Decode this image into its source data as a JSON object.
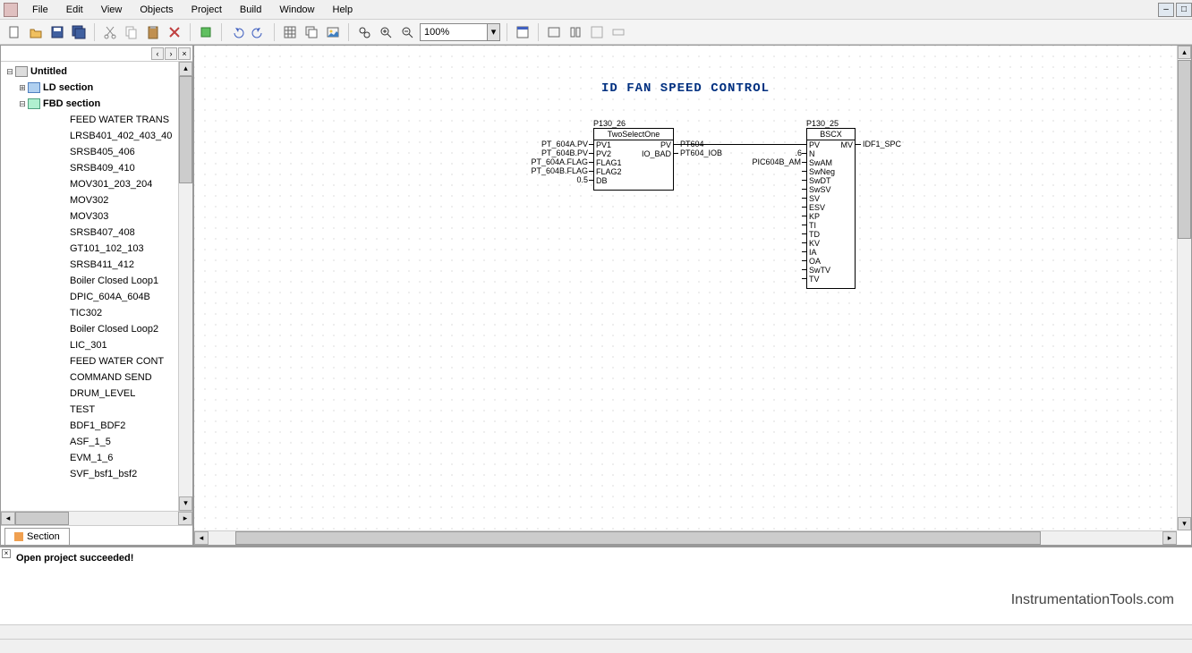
{
  "menus": [
    "File",
    "Edit",
    "View",
    "Objects",
    "Project",
    "Build",
    "Window",
    "Help"
  ],
  "zoom": "100%",
  "tree": {
    "root": "Untitled",
    "ld_label": "LD section",
    "fbd_label": "FBD section",
    "items": [
      "FEED WATER TRANS",
      "LRSB401_402_403_40",
      "SRSB405_406",
      "SRSB409_410",
      "MOV301_203_204",
      "MOV302",
      "MOV303",
      "SRSB407_408",
      "GT101_102_103",
      "SRSB411_412",
      "Boiler Closed Loop1",
      "DPIC_604A_604B",
      "TIC302",
      "Boiler Closed Loop2",
      "LIC_301",
      "FEED WATER CONT",
      "COMMAND SEND",
      "DRUM_LEVEL",
      "TEST",
      "BDF1_BDF2",
      "ASF_1_5",
      "EVM_1_6",
      "SVF_bsf1_bsf2"
    ]
  },
  "sidebar_tab": "Section",
  "canvas": {
    "title": "ID FAN SPEED CONTROL",
    "block1": {
      "instance": "P130_26",
      "type": "TwoSelectOne",
      "left_pins": [
        "PV1",
        "PV2",
        "FLAG1",
        "FLAG2",
        "DB"
      ],
      "right_pins": [
        "PV",
        "IO_BAD"
      ],
      "left_ext": [
        "PT_604A.PV",
        "PT_604B.PV",
        "PT_604A.FLAG",
        "PT_604B.FLAG",
        "0.5"
      ],
      "right_ext": [
        "PT604",
        "PT604_IOB"
      ]
    },
    "block2": {
      "instance": "P130_25",
      "type": "BSCX",
      "left_pins": [
        "PV",
        "N",
        "SwAM",
        "SwNeg",
        "SwDT",
        "SwSV",
        "SV",
        "ESV",
        "KP",
        "TI",
        "TD",
        "KV",
        "IA",
        "OA",
        "SwTV",
        "TV"
      ],
      "right_pins": [
        "MV"
      ],
      "left_ext_1": ".6",
      "left_ext_2": "PIC604B_AM",
      "right_ext": "IDF1_SPC"
    }
  },
  "output": {
    "message": "Open project succeeded!",
    "brand": "InstrumentationTools.com"
  }
}
